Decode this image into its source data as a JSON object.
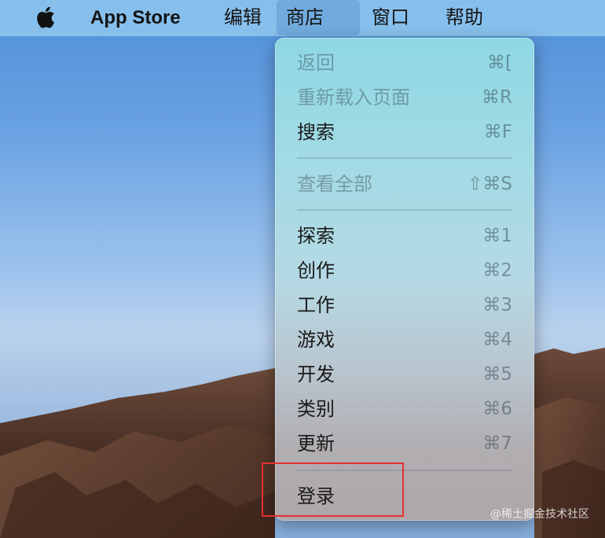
{
  "menubar": {
    "apple_icon": "apple-logo-icon",
    "app_name": "App Store",
    "items": [
      "编辑",
      "商店",
      "窗口",
      "帮助"
    ],
    "active_item": "商店"
  },
  "dropdown": {
    "items": [
      {
        "label": "返回",
        "shortcut": "⌘[",
        "enabled": false
      },
      {
        "label": "重新载入页面",
        "shortcut": "⌘R",
        "enabled": false
      },
      {
        "label": "搜索",
        "shortcut": "⌘F",
        "enabled": true
      },
      {
        "label": "查看全部",
        "shortcut": "⇧⌘S",
        "enabled": false
      },
      {
        "label": "探索",
        "shortcut": "⌘1",
        "enabled": true
      },
      {
        "label": "创作",
        "shortcut": "⌘2",
        "enabled": true
      },
      {
        "label": "工作",
        "shortcut": "⌘3",
        "enabled": true
      },
      {
        "label": "游戏",
        "shortcut": "⌘4",
        "enabled": true
      },
      {
        "label": "开发",
        "shortcut": "⌘5",
        "enabled": true
      },
      {
        "label": "类别",
        "shortcut": "⌘6",
        "enabled": true
      },
      {
        "label": "更新",
        "shortcut": "⌘7",
        "enabled": true
      },
      {
        "label": "登录",
        "shortcut": "",
        "enabled": true
      }
    ],
    "highlighted_item": "登录",
    "highlight_color": "#e53030"
  },
  "watermark": "@稀土掘金技术社区"
}
